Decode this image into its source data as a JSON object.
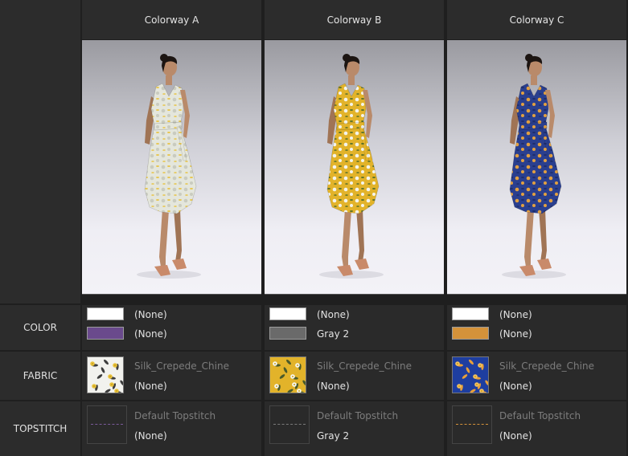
{
  "columns": [
    {
      "name": "Colorway A",
      "dress_colors": [
        "#e4e6dc",
        "#c9cbbf",
        "#e8c23c"
      ],
      "color_swatches": [
        {
          "color": "#ffffff",
          "label": "(None)"
        },
        {
          "color": "#6a4a8c",
          "label": "(None)"
        }
      ],
      "fabric": {
        "name": "Silk_Crepede_Chine",
        "value": "(None)",
        "bg": "#f2f2ee",
        "leaf": "#3d3d3d",
        "flower": "#e8c23c"
      },
      "topstitch": {
        "name": "Default Topstitch",
        "value": "(None)",
        "stitch": "#7a5a9a"
      }
    },
    {
      "name": "Colorway B",
      "dress_colors": [
        "#e2b32a",
        "#f4f4ec",
        "#4a6a2a"
      ],
      "color_swatches": [
        {
          "color": "#ffffff",
          "label": "(None)"
        },
        {
          "color": "#6a6a6a",
          "label": "Gray 2"
        }
      ],
      "fabric": {
        "name": "Silk_Crepede_Chine",
        "value": "(None)",
        "bg": "#e2b32a",
        "leaf": "#4a5a2a",
        "flower": "#f7f7f0"
      },
      "topstitch": {
        "name": "Default Topstitch",
        "value": "Gray 2",
        "stitch": "#7a7a7a"
      }
    },
    {
      "name": "Colorway C",
      "dress_colors": [
        "#2a3f8f",
        "#e2a040",
        "#1c2a66"
      ],
      "color_swatches": [
        {
          "color": "#ffffff",
          "label": "(None)"
        },
        {
          "color": "#d4923a",
          "label": "(None)"
        }
      ],
      "fabric": {
        "name": "Silk_Crepede_Chine",
        "value": "(None)",
        "bg": "#1e3ea0",
        "leaf": "#e8a03a",
        "flower": "#f2c060"
      },
      "topstitch": {
        "name": "Default Topstitch",
        "value": "(None)",
        "stitch": "#d4923a"
      }
    }
  ],
  "rows": {
    "color": "COLOR",
    "fabric": "FABRIC",
    "topstitch": "TOPSTITCH"
  }
}
